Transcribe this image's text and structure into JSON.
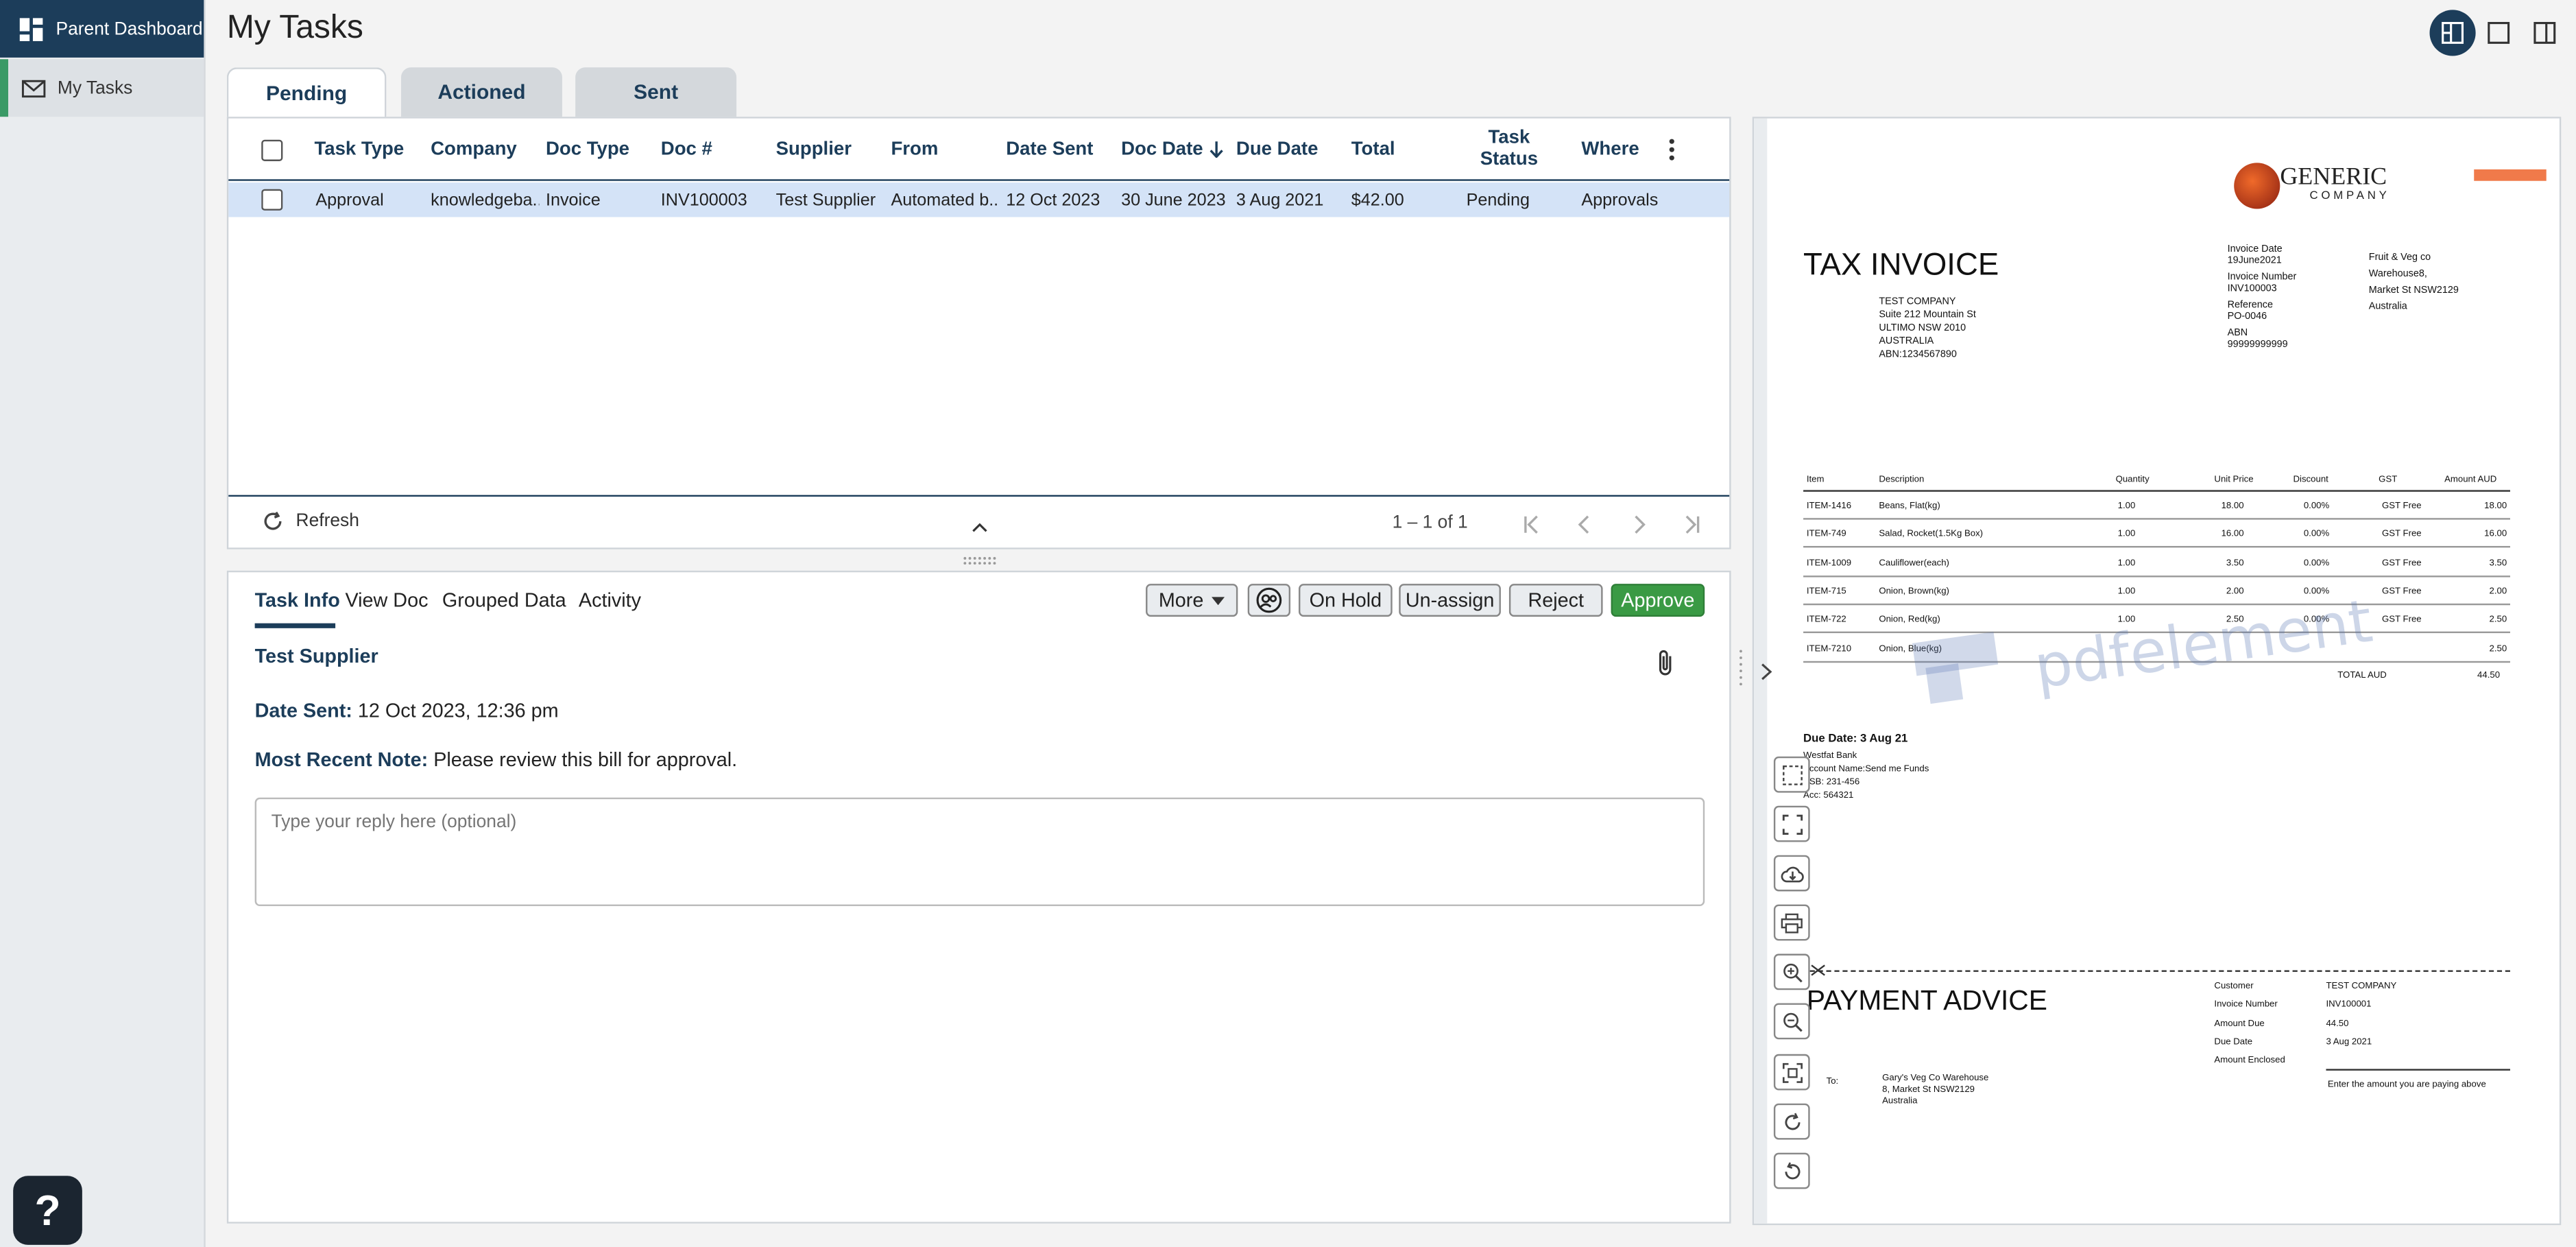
{
  "sidebar": {
    "items": [
      {
        "label": "Parent Dashboard",
        "icon": "dashboard-icon"
      },
      {
        "label": "My Tasks",
        "icon": "mail-icon"
      }
    ],
    "help_label": "?"
  },
  "header": {
    "title": "My Tasks"
  },
  "tabs": [
    {
      "label": "Pending",
      "active": true
    },
    {
      "label": "Actioned",
      "active": false
    },
    {
      "label": "Sent",
      "active": false
    }
  ],
  "grid": {
    "columns": [
      "Task Type",
      "Company",
      "Doc Type",
      "Doc #",
      "Supplier",
      "From",
      "Date Sent",
      "Doc Date",
      "Due Date",
      "Total",
      "Task Status",
      "Where"
    ],
    "rows": [
      {
        "task_type": "Approval",
        "company": "knowledgeba...",
        "doc_type": "Invoice",
        "doc_num": "INV100003",
        "supplier": "Test Supplier",
        "from": "Automated b...",
        "date_sent": "12 Oct 2023",
        "doc_date": "30 June 2023",
        "due_date": "3 Aug 2021",
        "total": "$42.00",
        "status": "Pending",
        "where": "Approvals"
      }
    ],
    "refresh_label": "Refresh",
    "pager_text": "1 – 1 of 1"
  },
  "detail": {
    "tabs": [
      "Task Info",
      "View Doc",
      "Grouped Data",
      "Activity"
    ],
    "actions": {
      "more": "More",
      "on_hold": "On Hold",
      "unassign": "Un-assign",
      "reject": "Reject",
      "approve": "Approve"
    },
    "supplier": "Test Supplier",
    "date_sent_label": "Date Sent:",
    "date_sent_value": "12 Oct 2023, 12:36 pm",
    "note_label": "Most Recent Note:",
    "note_value": "Please review this bill for approval.",
    "reply_placeholder": "Type your reply here (optional)"
  },
  "doc": {
    "logo_main": "GENERIC",
    "logo_sub": "COMPANY",
    "title": "TAX INVOICE",
    "bill_to": [
      "TEST COMPANY",
      "Suite 212 Mountain St",
      "ULTIMO NSW 2010",
      "AUSTRALIA",
      "ABN:1234567890"
    ],
    "invoice_date_label": "Invoice Date",
    "invoice_date": "19June2021",
    "invoice_number_label": "Invoice Number",
    "invoice_number": "INV100003",
    "reference_label": "Reference",
    "reference": "PO-0046",
    "abn_label": "ABN",
    "abn": "99999999999",
    "from_address": [
      "Fruit & Veg co",
      "Warehouse8,",
      "Market St NSW2129",
      "Australia"
    ],
    "line_headers": [
      "Item",
      "Description",
      "Quantity",
      "Unit Price",
      "Discount",
      "GST",
      "Amount AUD"
    ],
    "lines": [
      {
        "item": "ITEM-1416",
        "desc": "Beans, Flat(kg)",
        "qty": "1.00",
        "price": "18.00",
        "disc": "0.00%",
        "gst": "GST Free",
        "amt": "18.00"
      },
      {
        "item": "ITEM-749",
        "desc": "Salad, Rocket(1.5Kg Box)",
        "qty": "1.00",
        "price": "16.00",
        "disc": "0.00%",
        "gst": "GST Free",
        "amt": "16.00"
      },
      {
        "item": "ITEM-1009",
        "desc": "Cauliflower(each)",
        "qty": "1.00",
        "price": "3.50",
        "disc": "0.00%",
        "gst": "GST Free",
        "amt": "3.50"
      },
      {
        "item": "ITEM-715",
        "desc": "Onion, Brown(kg)",
        "qty": "1.00",
        "price": "2.00",
        "disc": "0.00%",
        "gst": "GST Free",
        "amt": "2.00"
      },
      {
        "item": "ITEM-722",
        "desc": "Onion, Red(kg)",
        "qty": "1.00",
        "price": "2.50",
        "disc": "0.00%",
        "gst": "GST Free",
        "amt": "2.50"
      },
      {
        "item": "ITEM-7210",
        "desc": "Onion, Blue(kg)",
        "qty": "",
        "price": "",
        "disc": "",
        "gst": "",
        "amt": "2.50"
      }
    ],
    "total_label": "TOTAL AUD",
    "total_value": "44.50",
    "due_date_line": "Due Date: 3 Aug 21",
    "bank_lines": [
      "Westfat Bank",
      "Account Name:Send me Funds",
      "BSB: 231-456",
      "Acc: 564321"
    ],
    "watermark": "pdfelement",
    "payment_title": "PAYMENT ADVICE",
    "payment_to_label": "To:",
    "payment_to": [
      "Gary's Veg Co Warehouse",
      "8, Market St NSW2129",
      "Australia"
    ],
    "advice_rows": [
      {
        "label": "Customer",
        "value": "TEST COMPANY"
      },
      {
        "label": "Invoice Number",
        "value": "INV100001"
      },
      {
        "label": "Amount Due",
        "value": "44.50"
      },
      {
        "label": "Due Date",
        "value": "3 Aug 2021"
      },
      {
        "label": "Amount Enclosed",
        "value": ""
      }
    ],
    "enclosed_hint": "Enter the amount you are paying above"
  },
  "colors": {
    "primary": "#1c3d5a",
    "approve": "#3a9a44",
    "selected_row": "#d4e3f7",
    "accent_bar": "#3a9a66"
  }
}
